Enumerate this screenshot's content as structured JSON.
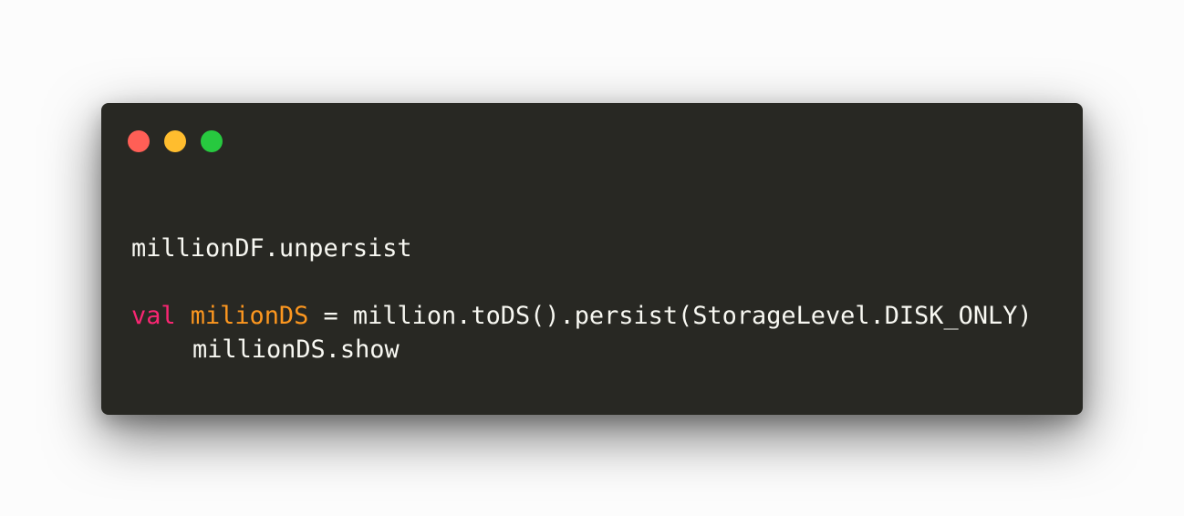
{
  "window": {
    "buttons": [
      {
        "name": "close",
        "color": "#ff5f56"
      },
      {
        "name": "minimize",
        "color": "#ffbd2e"
      },
      {
        "name": "maximize",
        "color": "#27c93f"
      }
    ]
  },
  "code": {
    "line1": "millionDF.unpersist",
    "line2": "",
    "line3": {
      "keyword": "val",
      "space1": " ",
      "identifier": "milionDS",
      "rest": " = million.toDS().persist(StorageLevel.DISK_ONLY)"
    },
    "line4": "millionDS.show"
  },
  "colors": {
    "background": "#fcfcfc",
    "editor_bg": "#282823",
    "text": "#f8f8f2",
    "keyword": "#f92672",
    "identifier": "#fd971f"
  }
}
